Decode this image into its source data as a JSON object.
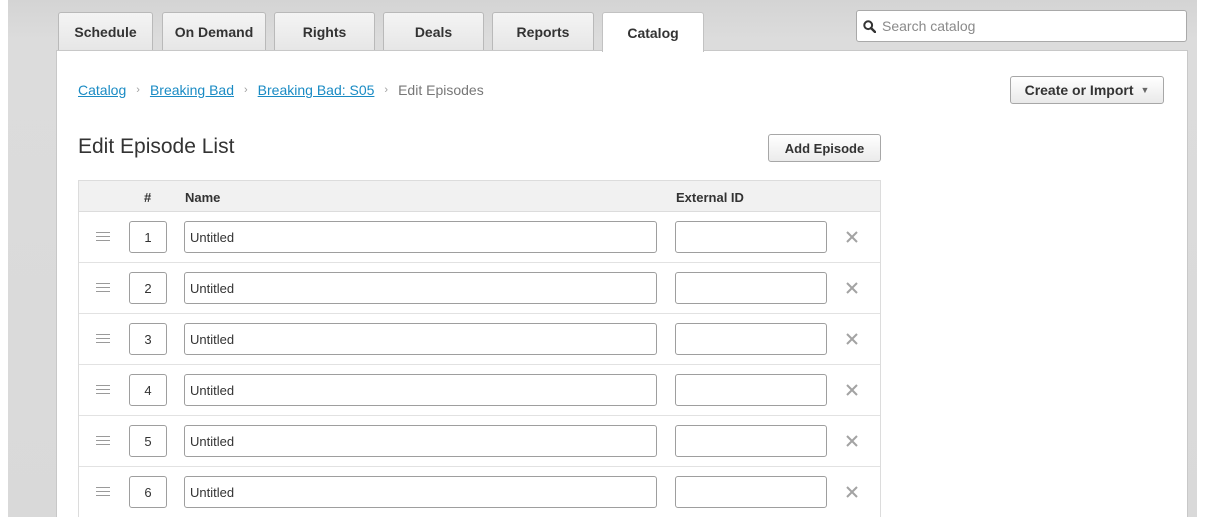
{
  "nav": {
    "tabs": [
      {
        "label": "Schedule",
        "active": false
      },
      {
        "label": "On Demand",
        "active": false
      },
      {
        "label": "Rights",
        "active": false
      },
      {
        "label": "Deals",
        "active": false
      },
      {
        "label": "Reports",
        "active": false
      },
      {
        "label": "Catalog",
        "active": true
      }
    ]
  },
  "search": {
    "placeholder": "Search catalog",
    "value": "",
    "icon": "search-icon"
  },
  "breadcrumb": {
    "items": [
      "Catalog",
      "Breaking Bad",
      "Breaking Bad: S05"
    ],
    "current": "Edit Episodes",
    "separator": "›"
  },
  "create_button": {
    "label": "Create or Import",
    "caret": "▼"
  },
  "page": {
    "title": "Edit Episode List",
    "add_button": "Add Episode"
  },
  "table": {
    "columns": {
      "number": "#",
      "name": "Name",
      "external_id": "External ID"
    },
    "rows": [
      {
        "number": "1",
        "name": "Untitled",
        "external_id": ""
      },
      {
        "number": "2",
        "name": "Untitled",
        "external_id": ""
      },
      {
        "number": "3",
        "name": "Untitled",
        "external_id": ""
      },
      {
        "number": "4",
        "name": "Untitled",
        "external_id": ""
      },
      {
        "number": "5",
        "name": "Untitled",
        "external_id": ""
      },
      {
        "number": "6",
        "name": "Untitled",
        "external_id": ""
      }
    ]
  },
  "colors": {
    "link": "#1a8bc4",
    "text": "#333333",
    "frame": "#d6d6d6"
  }
}
